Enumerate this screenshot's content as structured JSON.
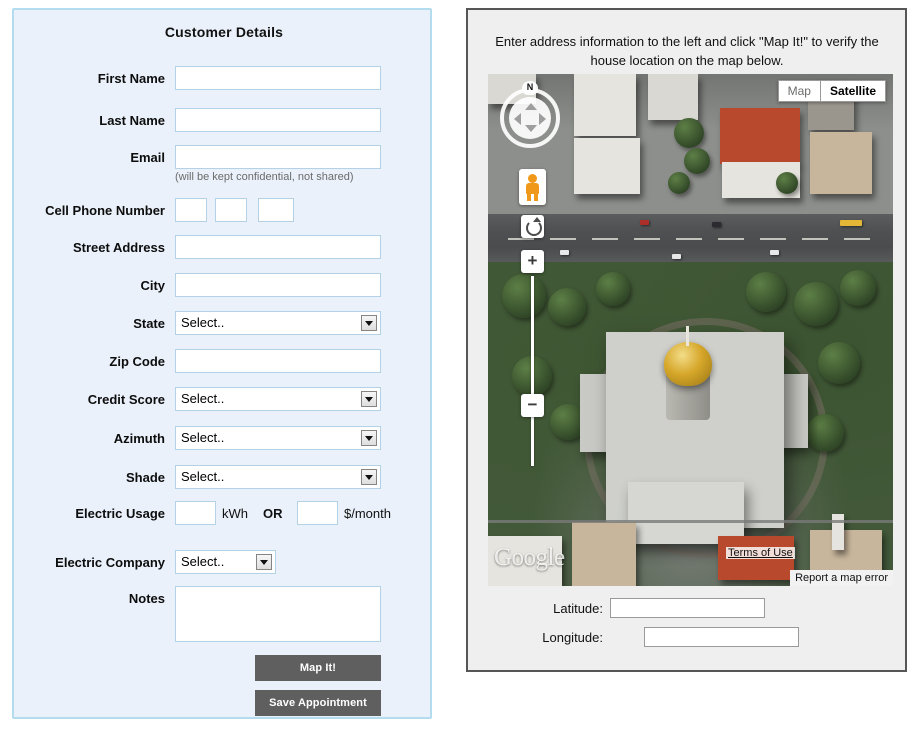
{
  "form": {
    "title": "Customer Details",
    "select_placeholder": "Select..",
    "email_hint": "(will be kept confidential, not shared)",
    "fields": [
      {
        "label": "First Name",
        "type": "text",
        "value": ""
      },
      {
        "label": "Last Name",
        "type": "text",
        "value": ""
      },
      {
        "label": "Email",
        "type": "text",
        "value": ""
      },
      {
        "label": "Cell Phone Number",
        "type": "phone",
        "value": ""
      },
      {
        "label": "Street Address",
        "type": "text",
        "value": ""
      },
      {
        "label": "City",
        "type": "text",
        "value": ""
      },
      {
        "label": "State",
        "type": "select",
        "value": "Select.."
      },
      {
        "label": "Zip Code",
        "type": "text",
        "value": ""
      },
      {
        "label": "Credit Score",
        "type": "select",
        "value": "Select.."
      },
      {
        "label": "Azimuth",
        "type": "select",
        "value": "Select.."
      },
      {
        "label": "Shade",
        "type": "select",
        "value": "Select.."
      },
      {
        "label": "Electric Usage",
        "type": "usage",
        "value": ""
      },
      {
        "label": "Electric Company",
        "type": "select",
        "value": "Select.."
      },
      {
        "label": "Notes",
        "type": "textarea",
        "value": ""
      }
    ],
    "usage": {
      "kwh_unit": "kWh",
      "or_text": "OR",
      "money_unit": "$/month",
      "kwh_value": "",
      "money_value": ""
    },
    "phone": {
      "area": "",
      "prefix": "",
      "line": ""
    },
    "buttons": {
      "map_it": "Map It!",
      "save_appointment": "Save Appointment"
    }
  },
  "map_panel": {
    "instruction": "Enter address information to the left and click \"Map It!\" to verify the house location on the map below.",
    "map_type": {
      "map_label": "Map",
      "satellite_label": "Satellite",
      "selected": "Satellite"
    },
    "controls": {
      "compass_north": "N",
      "zoom_in": "+",
      "zoom_out": "−",
      "pegman": "street-view-pegman",
      "rotate": "rotate-map"
    },
    "attribution": {
      "logo": "Google",
      "terms": "Terms of Use",
      "report": "Report a map error"
    },
    "coordinates": [
      {
        "label": "Latitude:",
        "value": ""
      },
      {
        "label": "Longitude:",
        "value": ""
      }
    ]
  },
  "colors": {
    "panel_bg": "#eaf1fa",
    "panel_border": "#b3dcee",
    "button_bg": "#5f5f5f",
    "map_panel_bg": "#efefef",
    "map_panel_border": "#565656",
    "input_border": "#b3d2e5"
  }
}
